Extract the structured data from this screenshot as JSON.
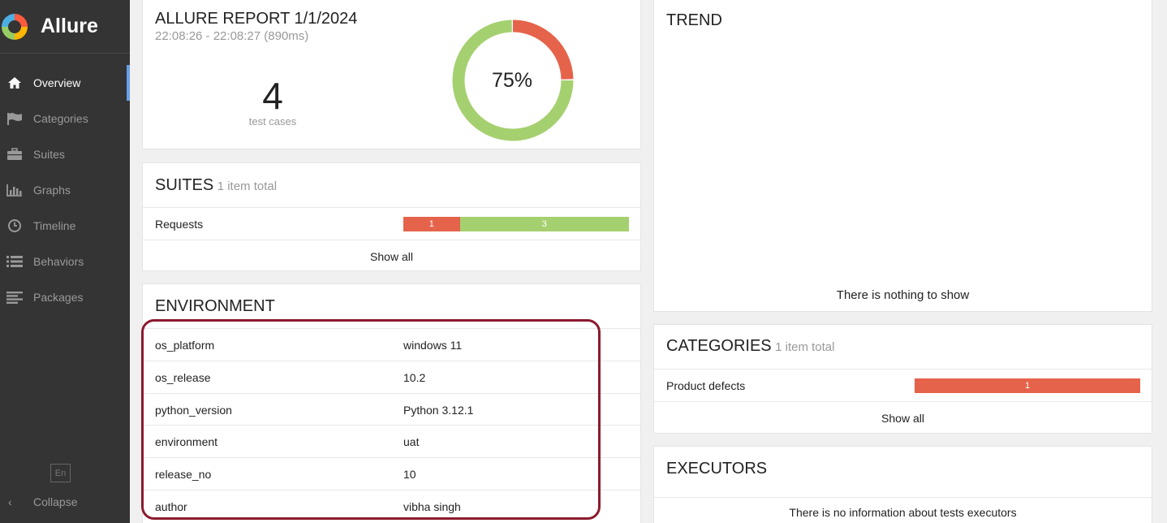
{
  "app": {
    "name": "Allure"
  },
  "nav": [
    {
      "label": "Overview",
      "icon": "home-icon",
      "active": true
    },
    {
      "label": "Categories",
      "icon": "flag-icon"
    },
    {
      "label": "Suites",
      "icon": "briefcase-icon"
    },
    {
      "label": "Graphs",
      "icon": "bar-chart-icon"
    },
    {
      "label": "Timeline",
      "icon": "clock-icon"
    },
    {
      "label": "Behaviors",
      "icon": "list-icon"
    },
    {
      "label": "Packages",
      "icon": "align-left-icon"
    }
  ],
  "language": "En",
  "collapse_label": "Collapse",
  "summary": {
    "title": "ALLURE REPORT 1/1/2024",
    "time": "22:08:26 - 22:08:27 (890ms)",
    "count": "4",
    "count_label": "test cases",
    "percent": "75%",
    "status": {
      "failed": 1,
      "passed": 3
    }
  },
  "suites": {
    "title": "SUITES",
    "subtitle": "1 item total",
    "items": [
      {
        "name": "Requests",
        "failed": "1",
        "passed": "3"
      }
    ],
    "show_all": "Show all"
  },
  "environment": {
    "title": "ENVIRONMENT",
    "rows": [
      {
        "key": "os_platform",
        "value": "windows 11"
      },
      {
        "key": "os_release",
        "value": "10.2"
      },
      {
        "key": "python_version",
        "value": "Python 3.12.1"
      },
      {
        "key": "environment",
        "value": "uat"
      },
      {
        "key": "release_no",
        "value": "10"
      },
      {
        "key": "author",
        "value": "vibha singh"
      }
    ]
  },
  "trend": {
    "title": "TREND",
    "empty": "There is nothing to show"
  },
  "categories": {
    "title": "CATEGORIES",
    "subtitle": "1 item total",
    "items": [
      {
        "name": "Product defects",
        "count": "1"
      }
    ],
    "show_all": "Show all"
  },
  "executors": {
    "title": "EXECUTORS",
    "empty": "There is no information about tests executors"
  },
  "colors": {
    "failed": "#e5634b",
    "passed": "#a5d06f",
    "sidebar": "#343434",
    "accent": "#6a9ee6",
    "highlight": "#8b1a2e"
  }
}
